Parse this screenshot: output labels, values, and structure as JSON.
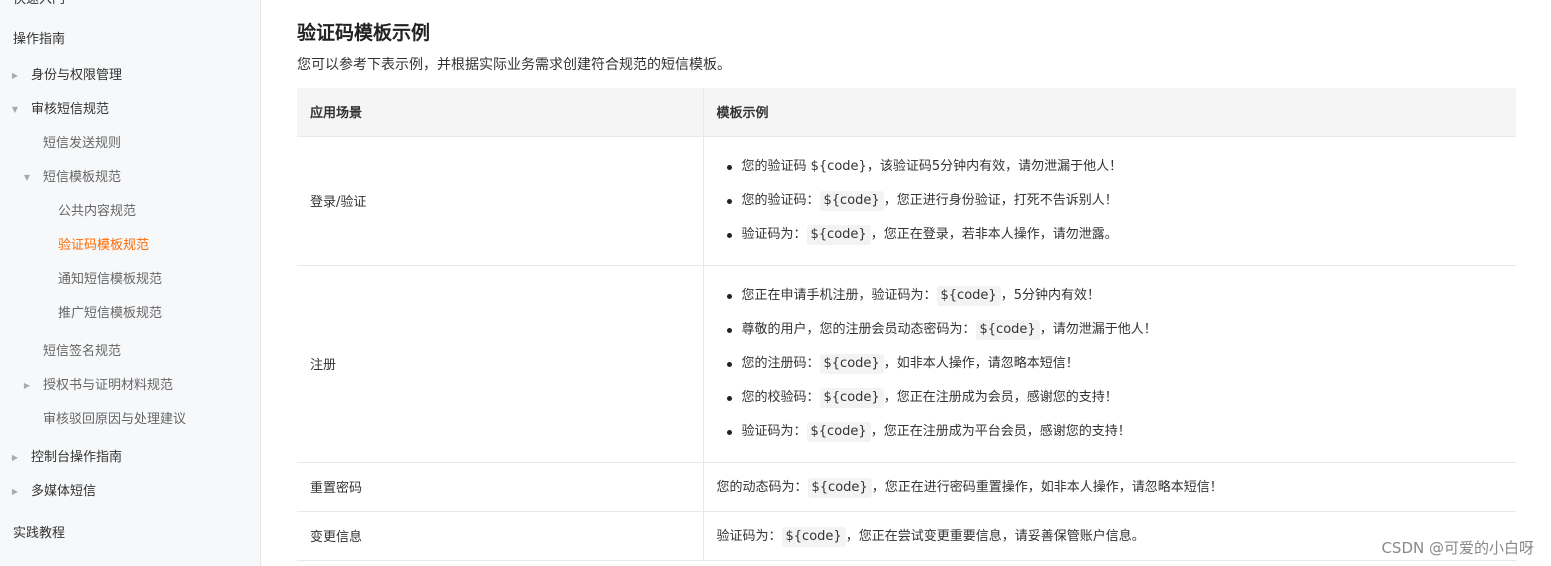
{
  "sidebar": {
    "items": [
      {
        "label": "快速入门",
        "level": 0,
        "arrow": "",
        "active": false
      },
      {
        "label": "操作指南",
        "level": 0,
        "arrow": "",
        "active": false
      },
      {
        "label": "身份与权限管理",
        "level": 1,
        "arrow": "▶",
        "active": false
      },
      {
        "label": "审核短信规范",
        "level": 1,
        "arrow": "▼",
        "active": false
      },
      {
        "label": "短信发送规则",
        "level": 2,
        "arrow": "",
        "active": false
      },
      {
        "label": "短信模板规范",
        "level": 2,
        "arrow": "▼",
        "active": false
      },
      {
        "label": "公共内容规范",
        "level": 3,
        "arrow": "",
        "active": false
      },
      {
        "label": "验证码模板规范",
        "level": 3,
        "arrow": "",
        "active": true
      },
      {
        "label": "通知短信模板规范",
        "level": 3,
        "arrow": "",
        "active": false
      },
      {
        "label": "推广短信模板规范",
        "level": 3,
        "arrow": "",
        "active": false
      },
      {
        "label": "短信签名规范",
        "level": 2,
        "arrow": "",
        "active": false
      },
      {
        "label": "授权书与证明材料规范",
        "level": 2,
        "arrow": "▶",
        "active": false
      },
      {
        "label": "审核驳回原因与处理建议",
        "level": 2,
        "arrow": "",
        "active": false
      },
      {
        "label": "控制台操作指南",
        "level": 1,
        "arrow": "▶",
        "active": false
      },
      {
        "label": "多媒体短信",
        "level": 1,
        "arrow": "▶",
        "active": false
      },
      {
        "label": "实践教程",
        "level": 0,
        "arrow": "",
        "active": false
      }
    ]
  },
  "main": {
    "title": "验证码模板示例",
    "description": "您可以参考下表示例，并根据实际业务需求创建符合规范的短信模板。",
    "table": {
      "headers": [
        "应用场景",
        "模板示例"
      ],
      "rows": [
        {
          "scene": "登录/验证",
          "examples": [
            {
              "pre": "您的验证码 ",
              "code": "${code}",
              "post": "，该验证码5分钟内有效，请勿泄漏于他人！",
              "hl": false
            },
            {
              "pre": "您的验证码：",
              "code": "${code}",
              "post": "，您正进行身份验证，打死不告诉别人！",
              "hl": true
            },
            {
              "pre": "验证码为：",
              "code": "${code}",
              "post": "，您正在登录，若非本人操作，请勿泄露。",
              "hl": true
            }
          ]
        },
        {
          "scene": "注册",
          "examples": [
            {
              "pre": "您正在申请手机注册，验证码为：",
              "code": "${code}",
              "post": "，5分钟内有效！",
              "hl": true
            },
            {
              "pre": "尊敬的用户，您的注册会员动态密码为：",
              "code": "${code}",
              "post": "，请勿泄漏于他人！",
              "hl": true
            },
            {
              "pre": "您的注册码：",
              "code": "${code}",
              "post": "，如非本人操作，请忽略本短信！",
              "hl": true
            },
            {
              "pre": "您的校验码：",
              "code": "${code}",
              "post": "，您正在注册成为会员，感谢您的支持！",
              "hl": true
            },
            {
              "pre": "验证码为：",
              "code": "${code}",
              "post": "，您正在注册成为平台会员，感谢您的支持！",
              "hl": true
            }
          ]
        },
        {
          "scene": "重置密码",
          "single": {
            "pre": "您的动态码为：",
            "code": "${code}",
            "post": "，您正在进行密码重置操作，如非本人操作，请忽略本短信！"
          }
        },
        {
          "scene": "变更信息",
          "single": {
            "pre": "验证码为：",
            "code": "${code}",
            "post": "，您正在尝试变更重要信息，请妥善保管账户信息。"
          }
        }
      ]
    }
  },
  "watermark": "CSDN @可爱的小白呀",
  "colors": {
    "accent": "#ff6a00",
    "sidebar_bg": "#f7f8fa",
    "header_bg": "#f5f5f5"
  }
}
